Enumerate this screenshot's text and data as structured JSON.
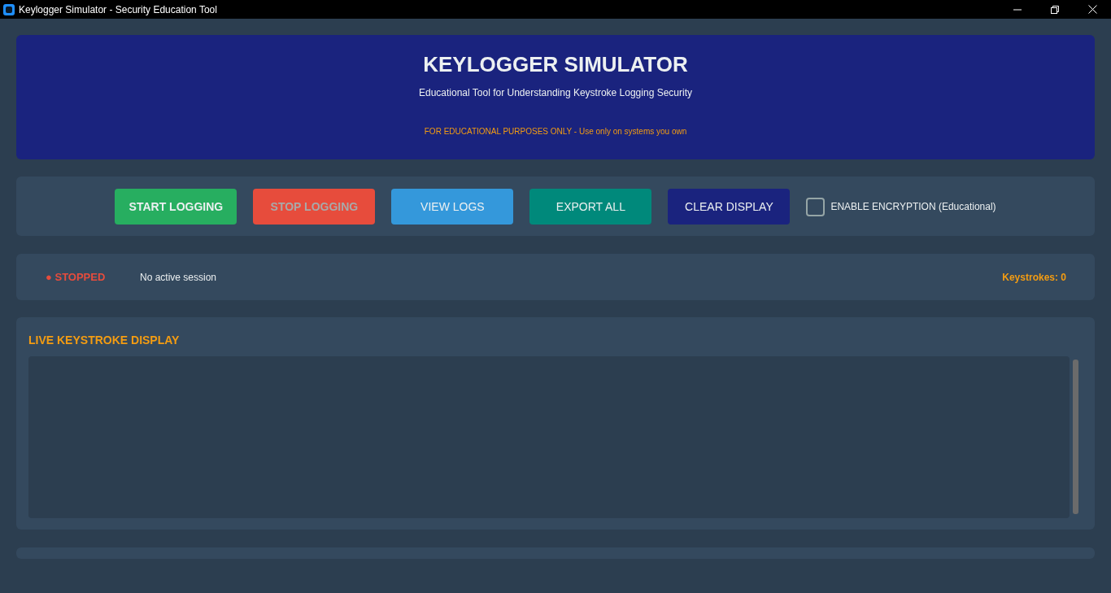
{
  "window": {
    "title": "Keylogger Simulator - Security Education Tool"
  },
  "header": {
    "title": "KEYLOGGER SIMULATOR",
    "subtitle": "Educational Tool for Understanding Keystroke Logging Security",
    "warning": "FOR EDUCATIONAL PURPOSES ONLY - Use only on systems you own"
  },
  "controls": {
    "buttons": [
      {
        "label": "START LOGGING",
        "kind": "session",
        "color": "#27ae60",
        "disabled": false
      },
      {
        "label": "STOP LOGGING",
        "kind": "session",
        "color": "#e74c3c",
        "disabled": true
      },
      {
        "label": "VIEW LOGS",
        "kind": "action",
        "color": "#3498db",
        "disabled": false
      },
      {
        "label": "EXPORT ALL",
        "kind": "action",
        "color": "#00897b",
        "disabled": false
      },
      {
        "label": "CLEAR DISPLAY",
        "kind": "action",
        "color": "#1a237e",
        "disabled": false
      }
    ],
    "encryption": {
      "label": "ENABLE ENCRYPTION (Educational)",
      "checked": false
    }
  },
  "status": {
    "state": "● STOPPED",
    "running": false,
    "session": "No active session",
    "keystrokes": "Keystrokes: 0"
  },
  "display": {
    "title": "LIVE KEYSTROKE DISPLAY"
  }
}
